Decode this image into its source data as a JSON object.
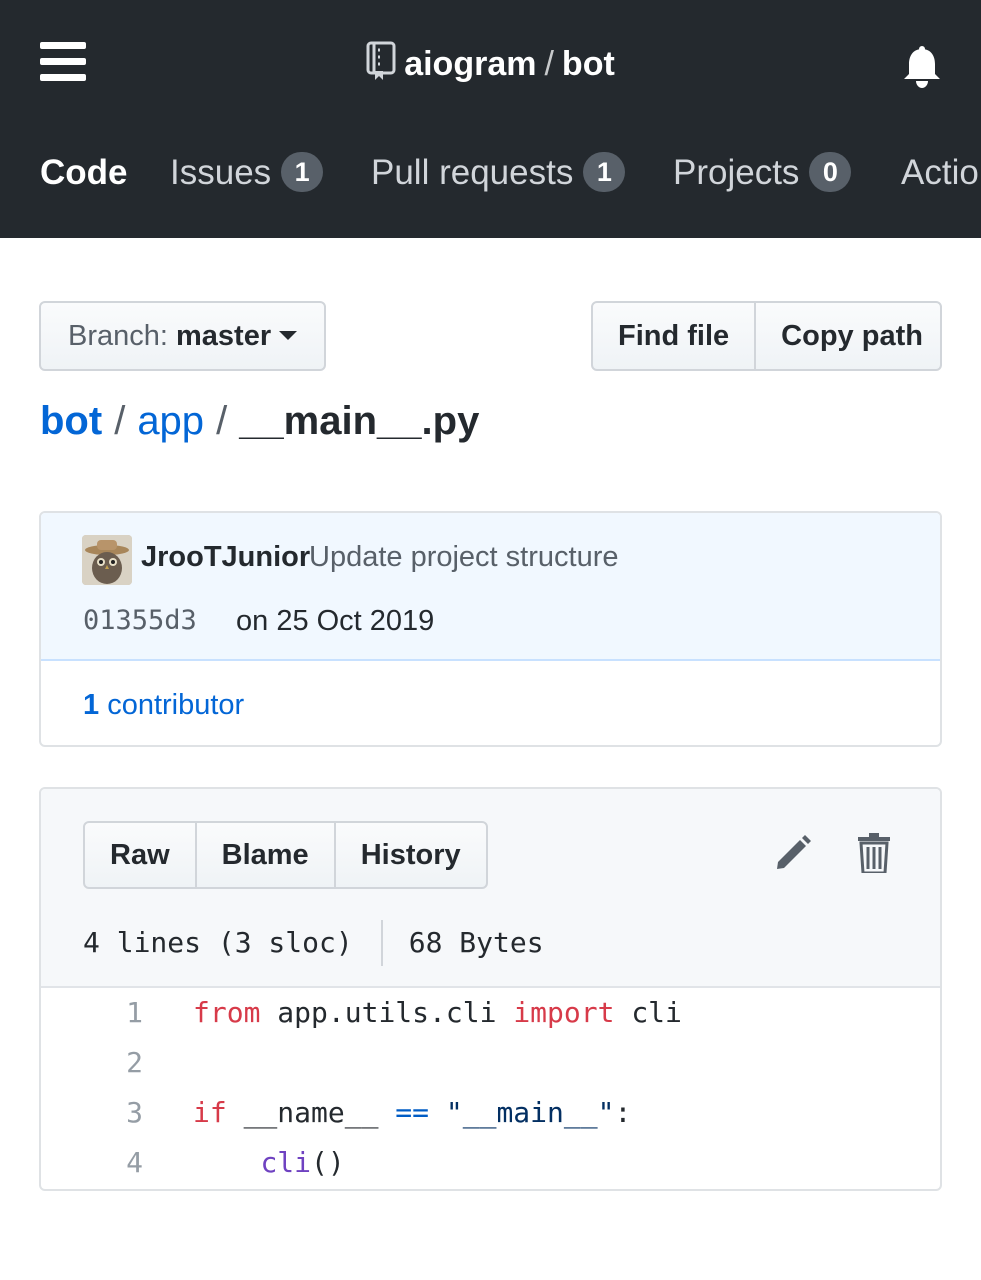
{
  "header": {
    "owner": "aiogram",
    "separator": "/",
    "repo": "bot",
    "tabs": [
      {
        "label": "Code"
      },
      {
        "label": "Issues",
        "count": "1"
      },
      {
        "label": "Pull requests",
        "count": "1"
      },
      {
        "label": "Projects",
        "count": "0"
      },
      {
        "label": "Actio"
      }
    ]
  },
  "toolbar": {
    "branch_label": "Branch:",
    "branch_value": "master",
    "find_file": "Find file",
    "copy_path": "Copy path"
  },
  "breadcrumb": {
    "root": "bot",
    "sep": "/",
    "folder": "app",
    "file": "__main__.py"
  },
  "commit": {
    "author": "JrooTJunior",
    "message": "Update project structure",
    "sha": "01355d3",
    "date": "on 25 Oct 2019",
    "contributors_count": "1",
    "contributors_label": "contributor"
  },
  "file": {
    "actions": {
      "raw": "Raw",
      "blame": "Blame",
      "history": "History"
    },
    "lines_info": "4 lines (3 sloc)",
    "size": "68 Bytes"
  },
  "code": [
    {
      "n": "1",
      "tokens": [
        [
          "kw",
          "from"
        ],
        [
          "",
          " app.utils.cli "
        ],
        [
          "kw",
          "import"
        ],
        [
          "",
          " cli"
        ]
      ]
    },
    {
      "n": "2",
      "tokens": []
    },
    {
      "n": "3",
      "tokens": [
        [
          "kw",
          "if"
        ],
        [
          "",
          " __name__ "
        ],
        [
          "op",
          "=="
        ],
        [
          "",
          " "
        ],
        [
          "str",
          "\"__main__\""
        ],
        [
          "",
          ":"
        ]
      ]
    },
    {
      "n": "4",
      "tokens": [
        [
          "",
          "    "
        ],
        [
          "fn",
          "cli"
        ],
        [
          "",
          "()"
        ]
      ]
    }
  ],
  "colors": {
    "header_bg": "#24292e",
    "link": "#0366d6",
    "keyword": "#d73a49",
    "function": "#6f42c1",
    "string": "#032f62",
    "commit_bg": "#f1f8ff"
  },
  "icons": {
    "menu": "hamburger-icon",
    "repo": "repo-icon",
    "notifications": "bell-icon",
    "edit": "pencil-icon",
    "delete": "trash-icon"
  }
}
